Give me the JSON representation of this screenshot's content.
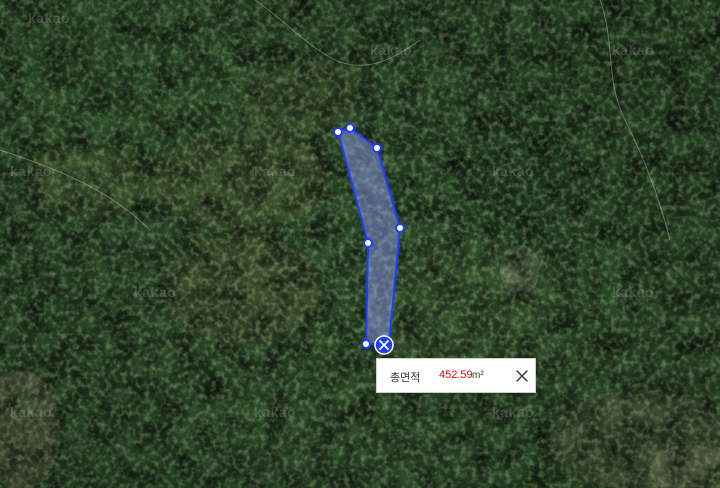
{
  "map": {
    "watermark_text": "kakao",
    "map_type": "satellite",
    "polygon_color": "#1f3cff",
    "polygon_fill": "rgba(150,160,255,0.45)"
  },
  "popup": {
    "label": "총면적",
    "value": "452.59",
    "unit": "m²",
    "value_color": "#e60012",
    "close_icon": "close-icon"
  }
}
